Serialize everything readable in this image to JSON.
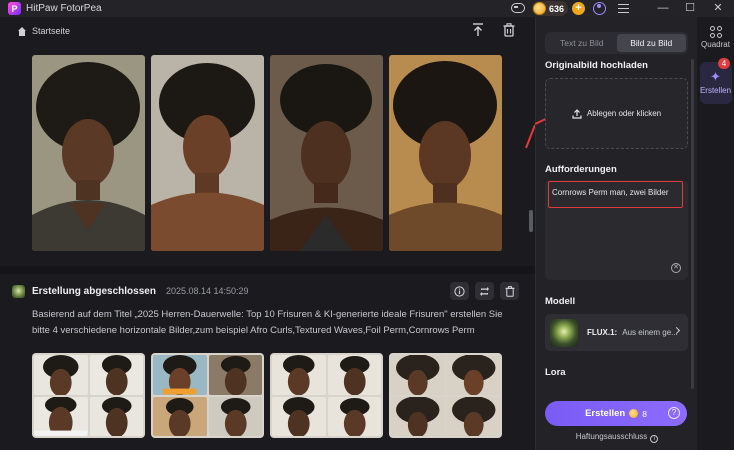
{
  "titlebar": {
    "app_title": "HitPaw FotorPea",
    "logo_letter": "P",
    "coins": "636",
    "window_controls": [
      "—",
      "☐",
      "✕"
    ]
  },
  "main": {
    "breadcrumb": "Startseite",
    "result": {
      "title": "Erstellung abgeschlossen",
      "time": "2025.08.14  14:50:29",
      "description": "Basierend auf dem Titel „2025 Herren-Dauerwelle: Top 10 Frisuren & KI-generierte ideale Frisuren\" erstellen Sie bitte 4 verschiedene horizontale Bilder,zum beispiel Afro Curls,Textured Waves,Foil Perm,Cornrows Perm"
    }
  },
  "panel": {
    "tabs": [
      {
        "label": "Text zu Bild",
        "active": false
      },
      {
        "label": "Bild zu Bild",
        "active": true
      }
    ],
    "upload_section": "Originalbild hochladen",
    "dropzone_text": "Ablegen oder klicken",
    "prompt_section": "Aufforderungen",
    "prompt_text": "Cornrows Perm man, zwei Bilder",
    "model_section": "Modell",
    "model_name": "FLUX.1:",
    "model_desc": "Aus einem ge...",
    "lora_section": "Lora",
    "create_label": "Erstellen",
    "create_cost": "8",
    "disclaimer": "Haftungsausschluss"
  },
  "rail": {
    "quadrat_label": "Quadrat",
    "erstellen_label": "Erstellen",
    "badge": "4"
  },
  "colors": {
    "accent": "#8c6bff",
    "highlight_red": "#e23b3b",
    "coin": "#f0a51c"
  }
}
